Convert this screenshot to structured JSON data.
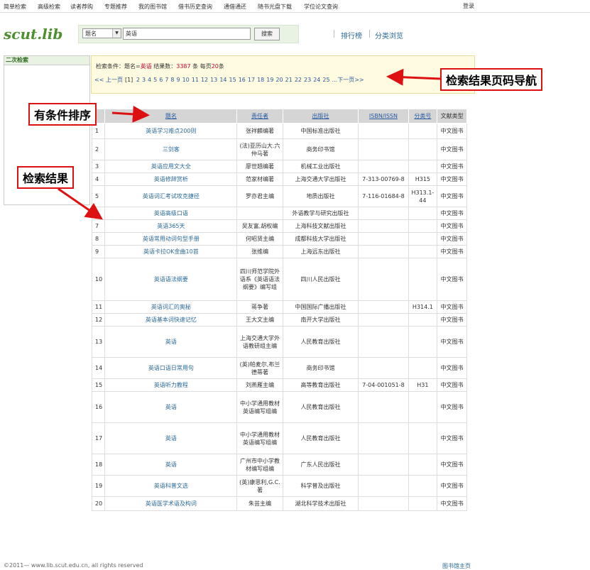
{
  "topnav": {
    "items": [
      "简单检索",
      "高级检索",
      "读者荐购",
      "专题推荐",
      "我的图书馆",
      "借书历史查询",
      "通借通还",
      "随书光盘下载",
      "学位论文查询"
    ],
    "login": "登录"
  },
  "logo": "scut.lib",
  "search": {
    "field": "题名",
    "query": "英语",
    "button": "搜索"
  },
  "links": {
    "ranking": "排行榜",
    "browse": "分类浏览"
  },
  "sidebar": {
    "title": "二次检索"
  },
  "condition": {
    "label": "检索条件：题名=",
    "term": "英语",
    "count_label": "结果数：",
    "count": "3387",
    "per_page_label": "条 每页",
    "per_page": "20",
    "per_page_unit": "条"
  },
  "pager": {
    "prev": "<< 上一页",
    "current": "[1]",
    "pages": [
      "2",
      "3",
      "4",
      "5",
      "6",
      "7",
      "8",
      "9",
      "10",
      "11",
      "12",
      "13",
      "14",
      "15",
      "16",
      "17",
      "18",
      "19",
      "20",
      "21",
      "22",
      "23",
      "24",
      "25"
    ],
    "next": "...下一页>>"
  },
  "table": {
    "headers": [
      "",
      "题名",
      "责任者",
      "出版社",
      "ISBN/ISSN",
      "分类号",
      "文献类型"
    ],
    "rows": [
      {
        "no": "1",
        "title": "英语学习难点200则",
        "author": "张祥麟编著",
        "publisher": "中国标准出版社",
        "isbn": "",
        "cls": "",
        "type": "中文图书"
      },
      {
        "no": "2",
        "title": "三剑客",
        "author": "(法)亚历山大.六仲马著",
        "publisher": "商务印书馆",
        "isbn": "",
        "cls": "",
        "type": "中文图书"
      },
      {
        "no": "3",
        "title": "英语应用文大全",
        "author": "廖世翘编著",
        "publisher": "机械工业出版社",
        "isbn": "",
        "cls": "",
        "type": "中文图书"
      },
      {
        "no": "4",
        "title": "英语修辞赏析",
        "author": "范家材编著",
        "publisher": "上海交通大学出版社",
        "isbn": "7-313-00769-8",
        "cls": "H315",
        "type": "中文图书"
      },
      {
        "no": "5",
        "title": "英语词汇考试攻克捷径",
        "author": "罗亦君主编",
        "publisher": "地质出版社",
        "isbn": "7-116-01684-8",
        "cls": "H313.1-44",
        "type": "中文图书"
      },
      {
        "no": "6",
        "title": "英语高级口语",
        "author": "",
        "publisher": "外语教学与研究出版社",
        "isbn": "",
        "cls": "",
        "type": "中文图书"
      },
      {
        "no": "7",
        "title": "英语365天",
        "author": "吴友富,胡权编",
        "publisher": "上海科技文献出版社",
        "isbn": "",
        "cls": "",
        "type": "中文图书"
      },
      {
        "no": "8",
        "title": "英语常用动词句型手册",
        "author": "何昭贤主编",
        "publisher": "成都科技大学出版社",
        "isbn": "",
        "cls": "",
        "type": "中文图书"
      },
      {
        "no": "9",
        "title": "英语卡拉OK金曲10首",
        "author": "张维编",
        "publisher": "上海远东出版社",
        "isbn": "",
        "cls": "",
        "type": "中文图书"
      },
      {
        "no": "10",
        "title": "英语语法纲要",
        "author": "四川师范学院外语系《英语语法纲要》编写组",
        "publisher": "四川人民出版社",
        "isbn": "",
        "cls": "",
        "type": "中文图书"
      },
      {
        "no": "11",
        "title": "英语词汇的奥秘",
        "author": "蒋争著",
        "publisher": "中国国际广播出版社",
        "isbn": "",
        "cls": "H314.1",
        "type": "中文图书"
      },
      {
        "no": "12",
        "title": "英语基本词快速记忆",
        "author": "王大文主编",
        "publisher": "南开大学出版社",
        "isbn": "",
        "cls": "",
        "type": "中文图书"
      },
      {
        "no": "13",
        "title": "英语",
        "author": "上海交通大学外语教研组主编",
        "publisher": "人民教育出版社",
        "isbn": "",
        "cls": "",
        "type": "中文图书"
      },
      {
        "no": "14",
        "title": "英语口语日常用句",
        "author": "(英)帕麦尔,布兰德蒂著",
        "publisher": "商务印书馆",
        "isbn": "",
        "cls": "",
        "type": "中文图书"
      },
      {
        "no": "15",
        "title": "英语听力教程",
        "author": "刘燕雁主编",
        "publisher": "高等教育出版社",
        "isbn": "7-04-001051-8",
        "cls": "H31",
        "type": "中文图书"
      },
      {
        "no": "16",
        "title": "英语",
        "author": "中小学通用教材英语编写组编",
        "publisher": "人民教育出版社",
        "isbn": "",
        "cls": "",
        "type": "中文图书"
      },
      {
        "no": "17",
        "title": "英语",
        "author": "中小学通用教材英语编写组编",
        "publisher": "人民教育出版社",
        "isbn": "",
        "cls": "",
        "type": "中文图书"
      },
      {
        "no": "18",
        "title": "英语",
        "author": "广州市中小学教材编写组编",
        "publisher": "广东人民出版社",
        "isbn": "",
        "cls": "",
        "type": "中文图书"
      },
      {
        "no": "19",
        "title": "英语科普文选",
        "author": "(英)康恩利,G.C.著",
        "publisher": "科学普及出版社",
        "isbn": "",
        "cls": "",
        "type": "中文图书"
      },
      {
        "no": "20",
        "title": "英语医学术语及构词",
        "author": "朱芸主编",
        "publisher": "湖北科学技术出版社",
        "isbn": "",
        "cls": "",
        "type": "中文图书"
      }
    ]
  },
  "annotations": {
    "pager_nav": "检索结果页码导航",
    "sort": "有条件排序",
    "results": "检索结果"
  },
  "footer": {
    "copyright": "©2011— www.lib.scut.edu.cn, all rights reserved",
    "home": "图书馆主页"
  },
  "colors": {
    "accent_green": "#4e8f2e",
    "link_blue": "#2a6a9a",
    "highlight_red": "#cc0033",
    "annotation_red": "#dd1111"
  }
}
